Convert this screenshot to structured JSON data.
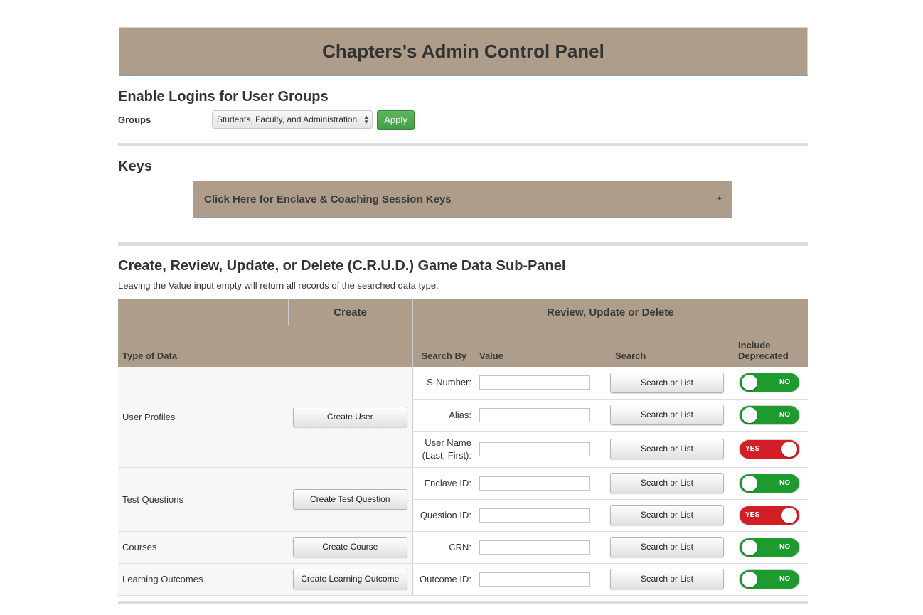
{
  "header": {
    "title": "Chapters's Admin Control Panel"
  },
  "logins": {
    "heading": "Enable Logins for User Groups",
    "groups_label": "Groups",
    "groups_selected": "Students, Faculty, and Administration",
    "apply_label": "Apply"
  },
  "keys": {
    "heading": "Keys",
    "accordion_label": "Click Here for Enclave & Coaching Session Keys",
    "expand_glyph": "+"
  },
  "crud": {
    "heading": "Create, Review, Update, or Delete (C.R.U.D.) Game Data Sub-Panel",
    "note": "Leaving the Value input empty will return all records of the searched data type.",
    "header_create": "Create",
    "header_rud": "Review, Update or Delete",
    "col_type": "Type of Data",
    "col_search_by": "Search By",
    "col_value": "Value",
    "col_search": "Search",
    "col_deprecated": "Include Deprecated",
    "search_button_label": "Search or List",
    "groups": [
      {
        "type": "User Profiles",
        "create_label": "Create User",
        "rows": [
          {
            "search_by": "S-Number:",
            "value": "",
            "toggle": "NO"
          },
          {
            "search_by": "Alias:",
            "value": "",
            "toggle": "NO"
          },
          {
            "search_by": "User Name (Last, First):",
            "value": "",
            "toggle": "YES"
          }
        ]
      },
      {
        "type": "Test Questions",
        "create_label": "Create Test Question",
        "rows": [
          {
            "search_by": "Enclave ID:",
            "value": "",
            "toggle": "NO"
          },
          {
            "search_by": "Question ID:",
            "value": "",
            "toggle": "YES"
          }
        ]
      },
      {
        "type": "Courses",
        "create_label": "Create Course",
        "rows": [
          {
            "search_by": "CRN:",
            "value": "",
            "toggle": "NO"
          }
        ]
      },
      {
        "type": "Learning Outcomes",
        "create_label": "Create Learning Outcome",
        "rows": [
          {
            "search_by": "Outcome ID:",
            "value": "",
            "toggle": "NO"
          }
        ]
      }
    ]
  },
  "colors": {
    "panel_tan": "#ad9d8a",
    "apply_green": "#449d44",
    "toggle_no": "#1d9b2e",
    "toggle_yes": "#d21f26"
  }
}
